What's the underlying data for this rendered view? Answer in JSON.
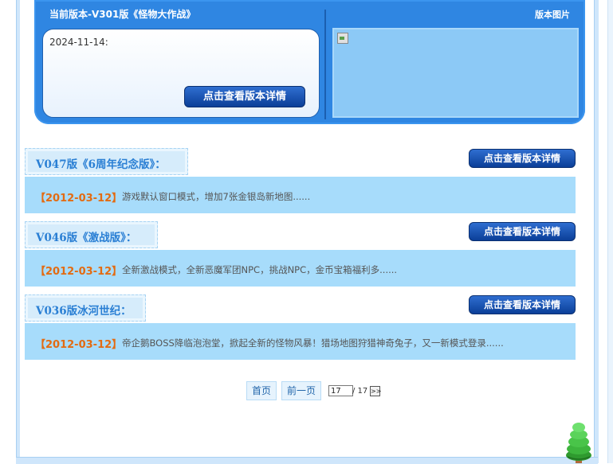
{
  "current_version": {
    "title": "当前版本-V301版《怪物大作战》",
    "date": "2024-11-14:",
    "detail_button": "点击查看版本详情",
    "image_title": "版本图片"
  },
  "versions": [
    {
      "name": "V047版《6周年纪念版》：",
      "date": "【2012-03-12】",
      "desc": "游戏默认窗口模式，增加7张金银岛新地图......",
      "detail_button": "点击查看版本详情"
    },
    {
      "name": "V046版《激战版》：",
      "date": "【2012-03-12】",
      "desc": "全新激战模式，全新恶魔军团NPC，挑战NPC，金币宝箱福利多......",
      "detail_button": "点击查看版本详情"
    },
    {
      "name": "V036版冰河世纪：",
      "date": "【2012-03-12】",
      "desc": "帝企鹅BOSS降临泡泡堂，掀起全新的怪物风暴！猎场地图狩猎神奇兔子，又一新模式登录......",
      "detail_button": "点击查看版本详情"
    }
  ],
  "pagination": {
    "first": "首页",
    "prev": "前一页",
    "current_page": "17",
    "total": "/ 17",
    "go": ">>"
  },
  "icons": {
    "broken_image": "broken-image-icon",
    "tree": "tree-icon"
  },
  "colors": {
    "banner": "#2f86e2",
    "accent_blue": "#2a7fd4",
    "date_orange": "#e36b12",
    "bar_bg": "#a7dcfb"
  }
}
